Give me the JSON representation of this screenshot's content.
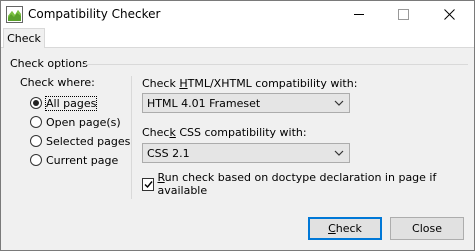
{
  "window": {
    "title": "Compatibility Checker"
  },
  "titlebar": {
    "min_icon": "minimize-icon",
    "max_icon": "maximize-icon",
    "close_icon": "close-icon"
  },
  "tabs": [
    {
      "label": "Check",
      "active": true
    }
  ],
  "options": {
    "group_label": "Check options",
    "check_where_label": "Check where:",
    "radios": [
      {
        "label": "All pages",
        "checked": true
      },
      {
        "label": "Open page(s)",
        "checked": false
      },
      {
        "label": "Selected pages",
        "checked": false
      },
      {
        "label": "Current page",
        "checked": false
      }
    ],
    "html_label_pre": "Check ",
    "html_label_mn": "H",
    "html_label_post": "TML/XHTML compatibility with:",
    "html_value": "HTML 4.01 Frameset",
    "css_label_pre": "Chec",
    "css_label_mn": "k",
    "css_label_post": " CSS compatibility with:",
    "css_value": "CSS 2.1",
    "doctype_label_mn": "R",
    "doctype_label_post": "un check based on doctype declaration in page if available",
    "doctype_checked": true
  },
  "buttons": {
    "check_mn": "C",
    "check_rest": "heck",
    "close": "Close"
  },
  "colors": {
    "accent": "#0078d7",
    "window_bg": "#f0f0f0"
  }
}
